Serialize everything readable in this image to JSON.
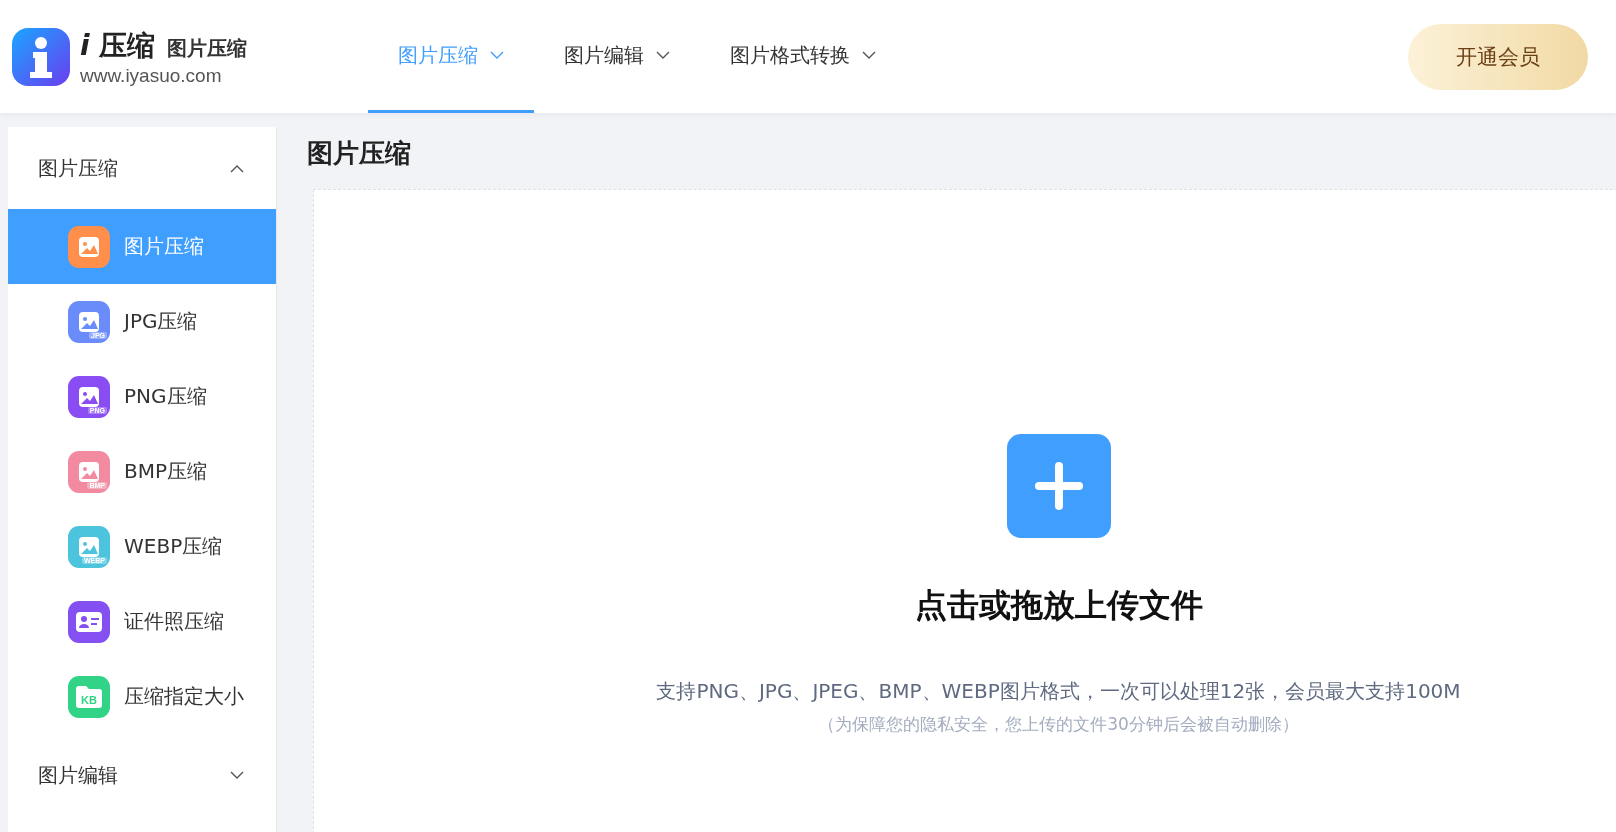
{
  "logo": {
    "name_mark": "i",
    "name": "压缩",
    "tagline": "图片压缩",
    "url": "www.iyasuo.com"
  },
  "nav": [
    {
      "label": "图片压缩",
      "selected": true
    },
    {
      "label": "图片编辑",
      "selected": false
    },
    {
      "label": "图片格式转换",
      "selected": false
    }
  ],
  "member_button": "开通会员",
  "sidebar": {
    "groups": [
      {
        "label": "图片压缩",
        "expanded": true,
        "items": [
          {
            "label": "图片压缩",
            "kind": "image",
            "color": "#ff8f4a",
            "selected": true
          },
          {
            "label": "JPG压缩",
            "kind": "image",
            "badge": "JPG",
            "color": "#6a8cfb",
            "selected": false
          },
          {
            "label": "PNG压缩",
            "kind": "image",
            "badge": "PNG",
            "color": "#8a4cf3",
            "selected": false
          },
          {
            "label": "BMP压缩",
            "kind": "image",
            "badge": "BMP",
            "color": "#f28ba0",
            "selected": false
          },
          {
            "label": "WEBP压缩",
            "kind": "image",
            "badge": "WEBP",
            "color": "#4cc4dd",
            "selected": false
          },
          {
            "label": "证件照压缩",
            "kind": "idcard",
            "color": "#8450f2",
            "selected": false
          },
          {
            "label": "压缩指定大小",
            "kind": "size",
            "badge": "KB",
            "color": "#31d487",
            "selected": false
          }
        ]
      },
      {
        "label": "图片编辑",
        "expanded": false
      }
    ]
  },
  "page_title": "图片压缩",
  "upload": {
    "prompt": "点击或拖放上传文件",
    "formats": "支持PNG、JPG、JPEG、BMP、WEBP图片格式，一次可以处理12张，会员最大支持100M",
    "privacy_note": "（为保障您的隐私安全，您上传的文件30分钟后会被自动删除）"
  }
}
